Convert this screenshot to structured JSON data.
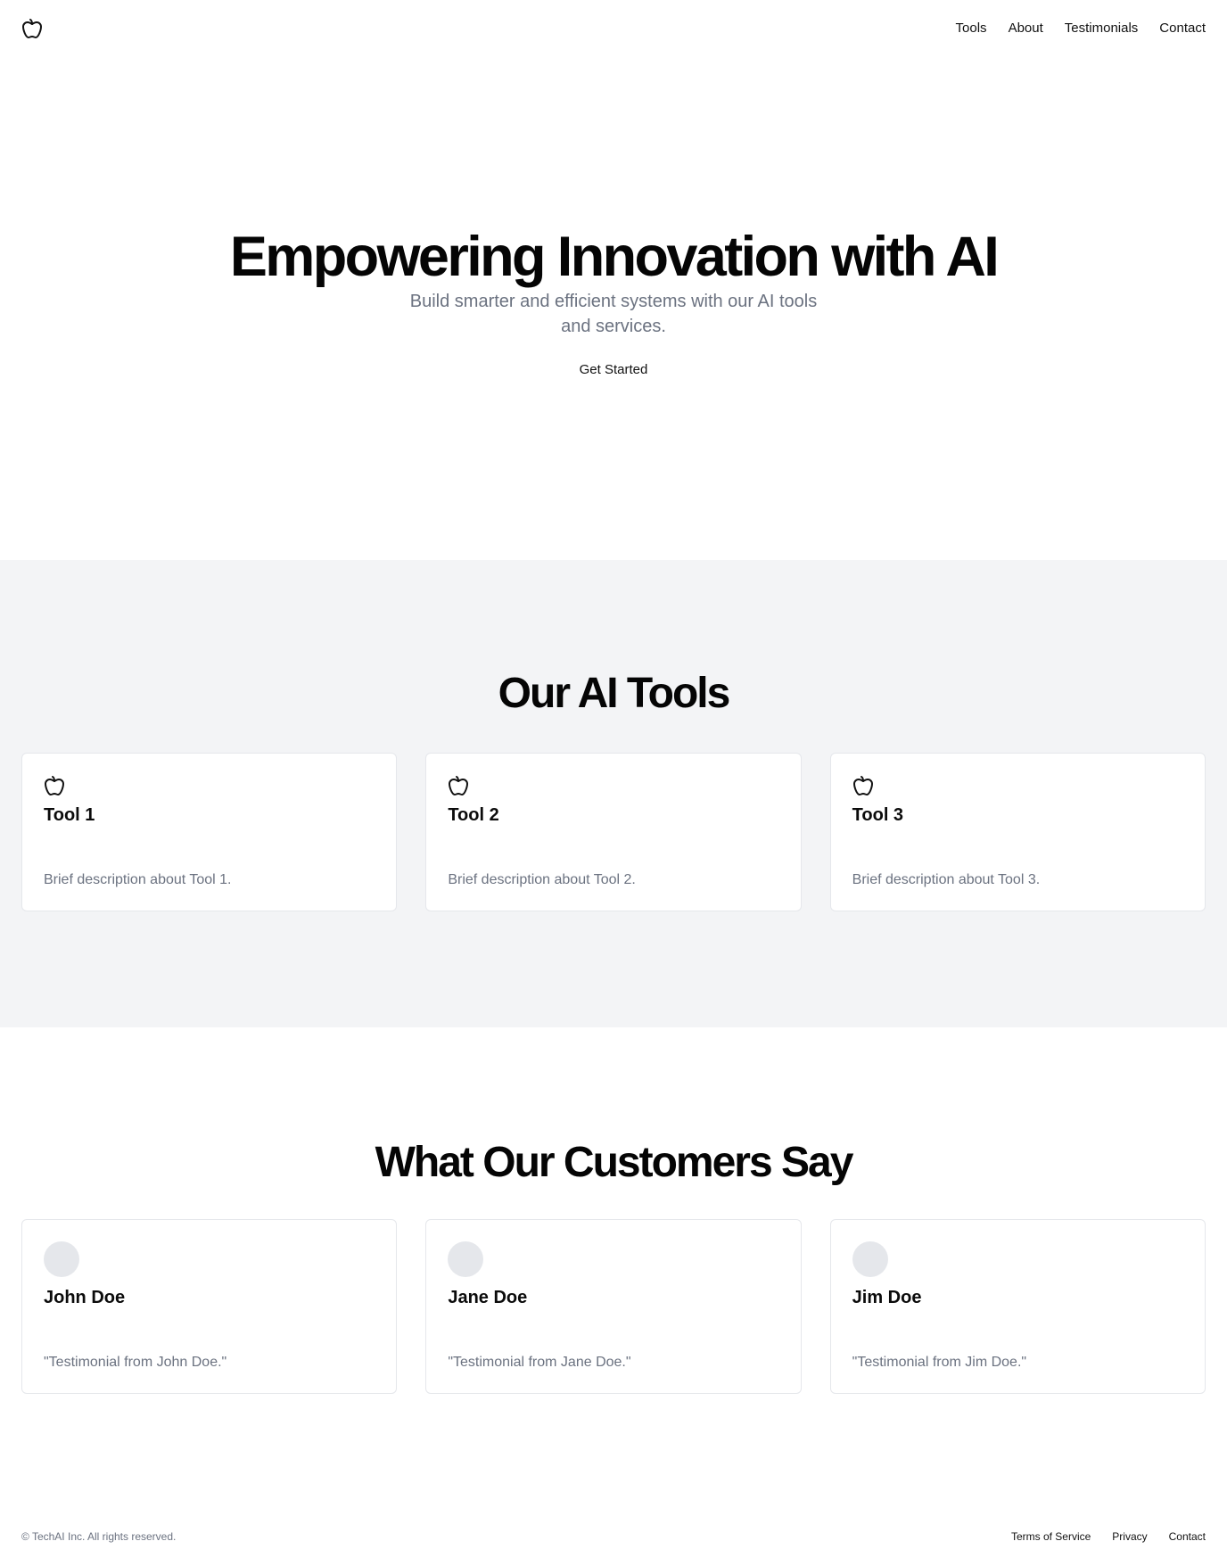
{
  "header": {
    "logo_icon": "apple-icon",
    "nav": [
      {
        "label": "Tools"
      },
      {
        "label": "About"
      },
      {
        "label": "Testimonials"
      },
      {
        "label": "Contact"
      }
    ]
  },
  "hero": {
    "title": "Empowering Innovation with AI",
    "subtitle": "Build smarter and efficient systems with our AI tools and services.",
    "cta_label": "Get Started"
  },
  "tools": {
    "title": "Our AI Tools",
    "background": "#f3f4f6",
    "items": [
      {
        "icon": "apple-icon",
        "name": "Tool 1",
        "description": "Brief description about Tool 1."
      },
      {
        "icon": "apple-icon",
        "name": "Tool 2",
        "description": "Brief description about Tool 2."
      },
      {
        "icon": "apple-icon",
        "name": "Tool 3",
        "description": "Brief description about Tool 3."
      }
    ]
  },
  "testimonials": {
    "title": "What Our Customers Say",
    "items": [
      {
        "name": "John Doe",
        "quote": "\"Testimonial from John Doe.\""
      },
      {
        "name": "Jane Doe",
        "quote": "\"Testimonial from Jane Doe.\""
      },
      {
        "name": "Jim Doe",
        "quote": "\"Testimonial from Jim Doe.\""
      }
    ]
  },
  "footer": {
    "copyright": "© TechAI Inc. All rights reserved.",
    "links": [
      {
        "label": "Terms of Service"
      },
      {
        "label": "Privacy"
      },
      {
        "label": "Contact"
      }
    ]
  },
  "colors": {
    "text": "#0b0b0b",
    "muted": "#6b7280",
    "section_bg": "#f3f4f6",
    "card_border": "#e5e7eb"
  }
}
